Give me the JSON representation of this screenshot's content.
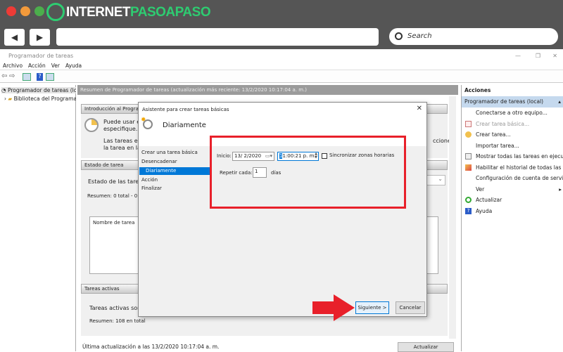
{
  "browser": {
    "logo_white": "INTERNET",
    "logo_green": "PASOAPASO",
    "search_placeholder": "Search",
    "dots": [
      "#ee3b36",
      "#f29a3b",
      "#4cae4c"
    ]
  },
  "window": {
    "title": "Programador de tareas",
    "menu": [
      "Archivo",
      "Acción",
      "Ver",
      "Ayuda"
    ]
  },
  "tree": {
    "items": [
      "Programador de tareas (local)",
      "Biblioteca del Programador"
    ]
  },
  "main": {
    "header": "Resumen de Programador de tareas (actualización más reciente: 13/2/2020 10:17:04 a. m.)",
    "intro_header": "Introducción al Programador",
    "intro_text1": "Puede usar el Pr",
    "intro_text2": "especifique. Par",
    "intro_text3": "Las tareas están",
    "intro_text4": "la tarea en la Bib",
    "intro_text_right": "ccione",
    "status_header": "Estado de tarea",
    "status_label": "Estado de las tareas qu",
    "status_summary": "Resumen: 0 total - 0 en",
    "task_name_col": "Nombre de tarea",
    "active_header": "Tareas activas",
    "active_text": "Tareas activas son tar",
    "active_summary": "Resumen: 108 en total",
    "last_update": "Última actualización a las 13/2/2020 10:17:04 a. m.",
    "refresh_button": "Actualizar"
  },
  "actions": {
    "title": "Acciones",
    "group": "Programador de tareas (local)",
    "items": [
      {
        "label": "Conectarse a otro equipo...",
        "icon": "none"
      },
      {
        "label": "Crear tarea básica...",
        "icon": "basic-task-icon",
        "disabled": true
      },
      {
        "label": "Crear tarea...",
        "icon": "create-task-icon"
      },
      {
        "label": "Importar tarea...",
        "icon": "none"
      },
      {
        "label": "Mostrar todas las tareas en ejecución",
        "icon": "running-tasks-icon"
      },
      {
        "label": "Habilitar el historial de todas las tar...",
        "icon": "history-icon"
      },
      {
        "label": "Configuración de cuenta de servici...",
        "icon": "none"
      },
      {
        "label": "Ver",
        "icon": "none"
      },
      {
        "label": "Actualizar",
        "icon": "refresh-icon"
      },
      {
        "label": "Ayuda",
        "icon": "help-icon"
      }
    ]
  },
  "dialog": {
    "title": "Asistente para crear tareas básicas",
    "heading": "Diariamente",
    "nav": [
      "Crear una tarea básica",
      "Desencadenar",
      "Diariamente",
      "Acción",
      "Finalizar"
    ],
    "start_label": "Inicio:",
    "start_date": "13/ 2/2020",
    "start_time_hl": "1",
    "start_time": "1:00:21 p. m.",
    "sync_label": "Sincronizar zonas horarias",
    "sync_checked": false,
    "repeat_label": "Repetir cada:",
    "repeat_value": "1",
    "repeat_unit": "días",
    "next_button": "Siguiente >",
    "cancel_button": "Cancelar"
  },
  "colors": {
    "highlight": "#e8202a",
    "selection": "#0078d7",
    "logo_green": "#2ecc71"
  }
}
